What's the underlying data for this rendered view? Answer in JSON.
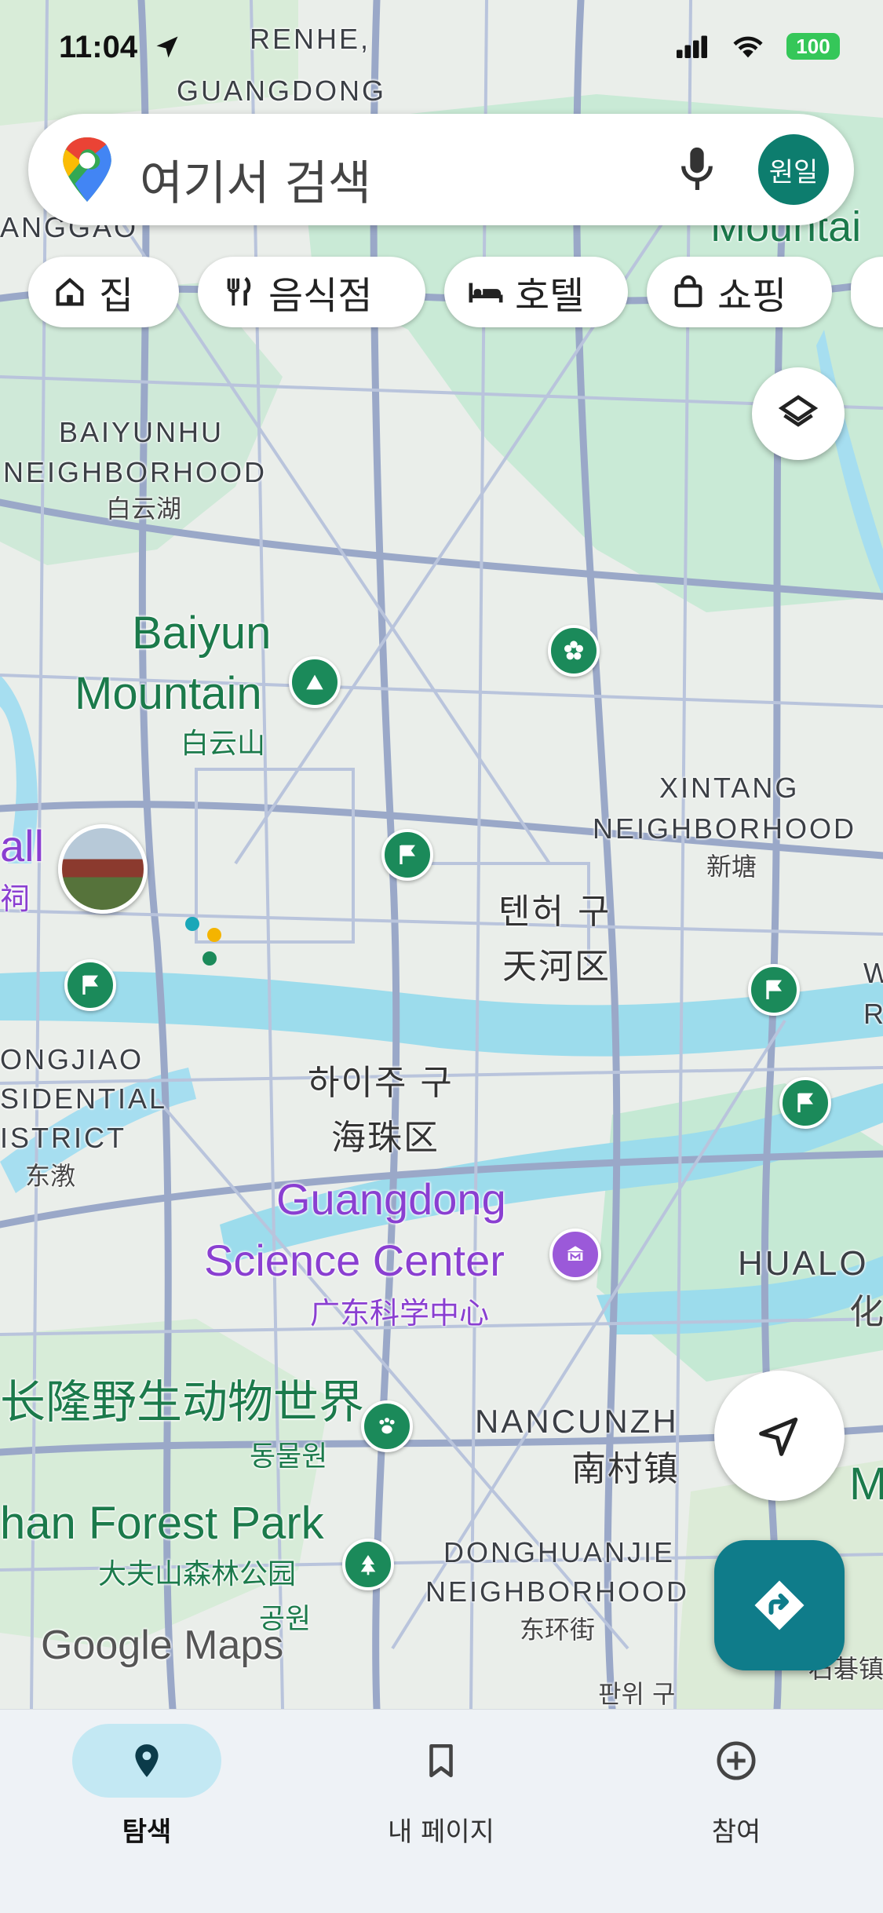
{
  "status_bar": {
    "time": "11:04",
    "battery": "100"
  },
  "search": {
    "placeholder": "여기서 검색",
    "avatar_text": "원일"
  },
  "chips": [
    {
      "label": "집",
      "icon": "home-icon"
    },
    {
      "label": "음식점",
      "icon": "restaurant-icon"
    },
    {
      "label": "호텔",
      "icon": "hotel-icon"
    },
    {
      "label": "쇼핑",
      "icon": "shopping-bag-icon"
    }
  ],
  "map": {
    "attribution": "Google Maps",
    "places": [
      {
        "text": "RENHE,",
        "style": "gray"
      },
      {
        "text": "GUANGDONG",
        "style": "gray"
      },
      {
        "text": "ANGGAO",
        "style": "gray"
      },
      {
        "text": "Mountai",
        "style": "green"
      },
      {
        "text": "BAIYUNHU",
        "style": "gray"
      },
      {
        "text": "NEIGHBORHOOD",
        "style": "gray"
      },
      {
        "text": "白云湖",
        "style": "gray-sm"
      },
      {
        "text": "Baiyun",
        "style": "green"
      },
      {
        "text": "Mountain",
        "style": "green"
      },
      {
        "text": "白云山",
        "style": "green-sm"
      },
      {
        "text": "XINTANG",
        "style": "gray"
      },
      {
        "text": "NEIGHBORHOOD",
        "style": "gray"
      },
      {
        "text": "新塘",
        "style": "gray-sm"
      },
      {
        "text": "텐허 구",
        "style": "dist"
      },
      {
        "text": "天河区",
        "style": "dist"
      },
      {
        "text": "all",
        "style": "purple"
      },
      {
        "text": "祠",
        "style": "purple-sm"
      },
      {
        "text": "ONGJIAO",
        "style": "gray"
      },
      {
        "text": "SIDENTIAL",
        "style": "gray"
      },
      {
        "text": "ISTRICT",
        "style": "gray"
      },
      {
        "text": "东漖",
        "style": "gray-sm"
      },
      {
        "text": "하이주 구",
        "style": "dist"
      },
      {
        "text": "海珠区",
        "style": "dist"
      },
      {
        "text": "Guangdong",
        "style": "purple"
      },
      {
        "text": "Science Center",
        "style": "purple"
      },
      {
        "text": "广东科学中心",
        "style": "purple-sm"
      },
      {
        "text": "HUALO",
        "style": "gray"
      },
      {
        "text": "化",
        "style": "gray-sm"
      },
      {
        "text": "长隆野生动物世界",
        "style": "green"
      },
      {
        "text": "동물원",
        "style": "green-sm"
      },
      {
        "text": "NANCUNZH",
        "style": "gray"
      },
      {
        "text": "南村镇",
        "style": "dist"
      },
      {
        "text": "han Forest Park",
        "style": "green"
      },
      {
        "text": "大夫山森林公园",
        "style": "green-sm"
      },
      {
        "text": "공원",
        "style": "green-sm"
      },
      {
        "text": "DONGHUANJIE",
        "style": "gray"
      },
      {
        "text": "NEIGHBORHOOD",
        "style": "gray"
      },
      {
        "text": "东环街",
        "style": "gray-sm"
      },
      {
        "text": "판위 구",
        "style": "gray-sm"
      },
      {
        "text": "石碁镇",
        "style": "gray-sm"
      },
      {
        "text": "W",
        "style": "gray"
      },
      {
        "text": "R",
        "style": "gray"
      },
      {
        "text": "M",
        "style": "green"
      }
    ]
  },
  "buttons": {
    "layers_icon": "layers-icon",
    "location_icon": "navigation-arrow-icon",
    "directions_icon": "directions-icon"
  },
  "bottom_nav": [
    {
      "label": "탐색",
      "icon": "explore-pin-icon",
      "active": true
    },
    {
      "label": "내 페이지",
      "icon": "bookmark-icon",
      "active": false
    },
    {
      "label": "참여",
      "icon": "add-circle-icon",
      "active": false
    }
  ],
  "colors": {
    "accent": "#0d7d6e",
    "water": "#9cdcec",
    "road": "#9aa8c8",
    "park": "#c8ead3",
    "purple": "#8a3fd1",
    "green": "#1b7a4b"
  }
}
